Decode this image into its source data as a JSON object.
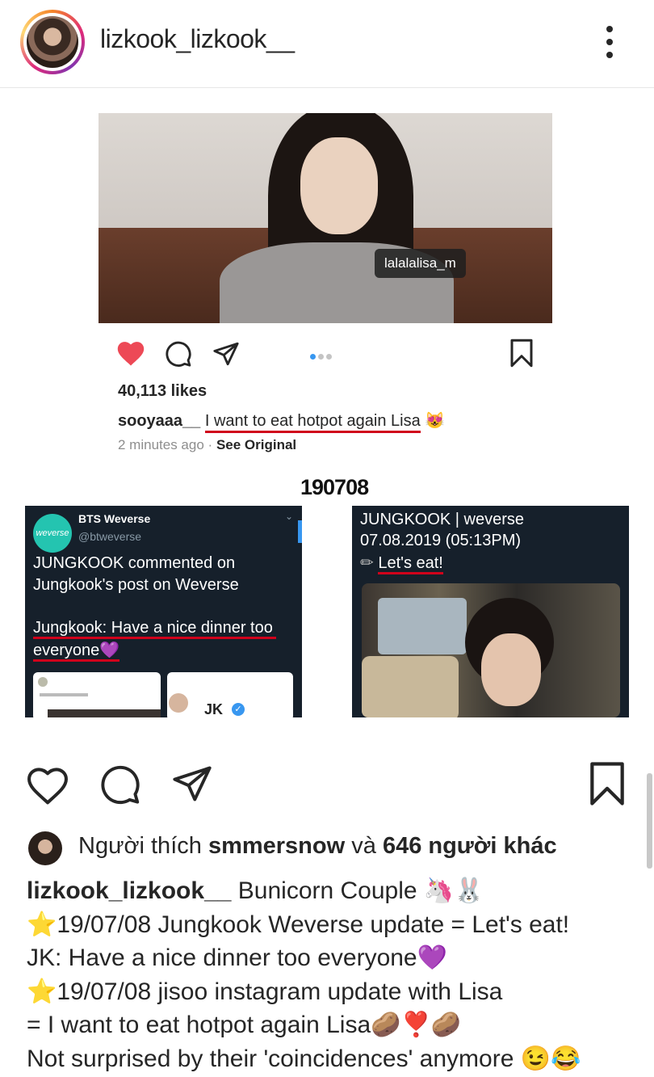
{
  "header": {
    "username": "lizkook_lizkook__",
    "avatar_icon": "profile-avatar",
    "more_icon": "more-options-icon"
  },
  "embedded_post": {
    "photo_tag": "lalalalisa_m",
    "likes": "40,113 likes",
    "caption_user": "sooyaaa__",
    "caption_text": "I want to eat hotpot again Lisa",
    "caption_emoji": "😻",
    "time_ago": "2 minutes ago",
    "separator": "·",
    "see_original": "See Original"
  },
  "date_label": "190708",
  "weverse_left": {
    "logo_text": "weverse",
    "account_name": "BTS Weverse",
    "handle": "@btweverse",
    "line1": "JUNGKOOK commented on",
    "line2": "Jungkook's post on Weverse",
    "line3": "Jungkook: Have a nice dinner too",
    "line4": "everyone💜",
    "mini_name": "JK"
  },
  "weverse_right": {
    "line1": "JUNGKOOK | weverse",
    "line2": "07.08.2019 (05:13PM)",
    "line3_icon": "✏",
    "line3": "Let's eat!"
  },
  "liked_by": {
    "prefix": "Người thích",
    "user": "smmersnow",
    "middle": "và",
    "others": "646 người khác"
  },
  "caption": {
    "user": "lizkook_lizkook__",
    "line1_text": " Bunicorn Couple 🦄🐰",
    "line2": "⭐19/07/08 Jungkook Weverse update = Let's eat!",
    "line3": "JK: Have a nice dinner too everyone💜",
    "line4": "⭐19/07/08 jisoo instagram update with Lisa",
    "line5": "= I want to eat hotpot again Lisa🥔❣️🥔",
    "line6": "Not surprised by their 'coincidences' anymore 😉😂"
  },
  "colors": {
    "heart_red": "#ed4956",
    "underline_red": "#d0021b",
    "dark_panel": "#16202b",
    "weverse_teal": "#24c4b0",
    "carousel_active": "#3897f0"
  }
}
